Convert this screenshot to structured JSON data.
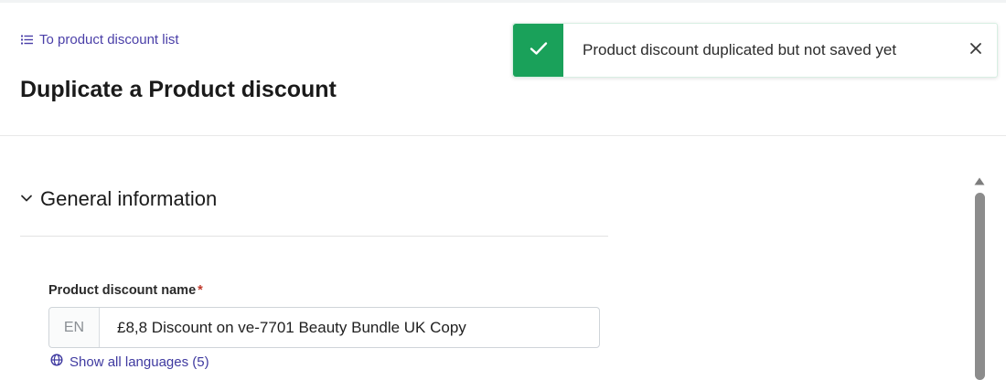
{
  "header": {
    "back_link": "To product discount list",
    "title": "Duplicate a Product discount"
  },
  "toast": {
    "message": "Product discount duplicated but not saved yet",
    "status": "success",
    "accent_color": "#1aa15a",
    "icon": "checkmark-icon",
    "close_icon": "close-icon"
  },
  "section": {
    "title": "General information",
    "expanded": true,
    "icon": "chevron-down-icon"
  },
  "form": {
    "name_label": "Product discount name",
    "required_mark": "*",
    "language_prefix": "EN",
    "name_value": "£8,8 Discount on ve-7701 Beauty Bundle UK Copy",
    "show_languages": "Show all languages (5)",
    "languages_icon": "globe-icon"
  },
  "colors": {
    "link": "#4a3fa8",
    "success": "#1aa15a",
    "scrollbar": "#8c8c8c"
  }
}
